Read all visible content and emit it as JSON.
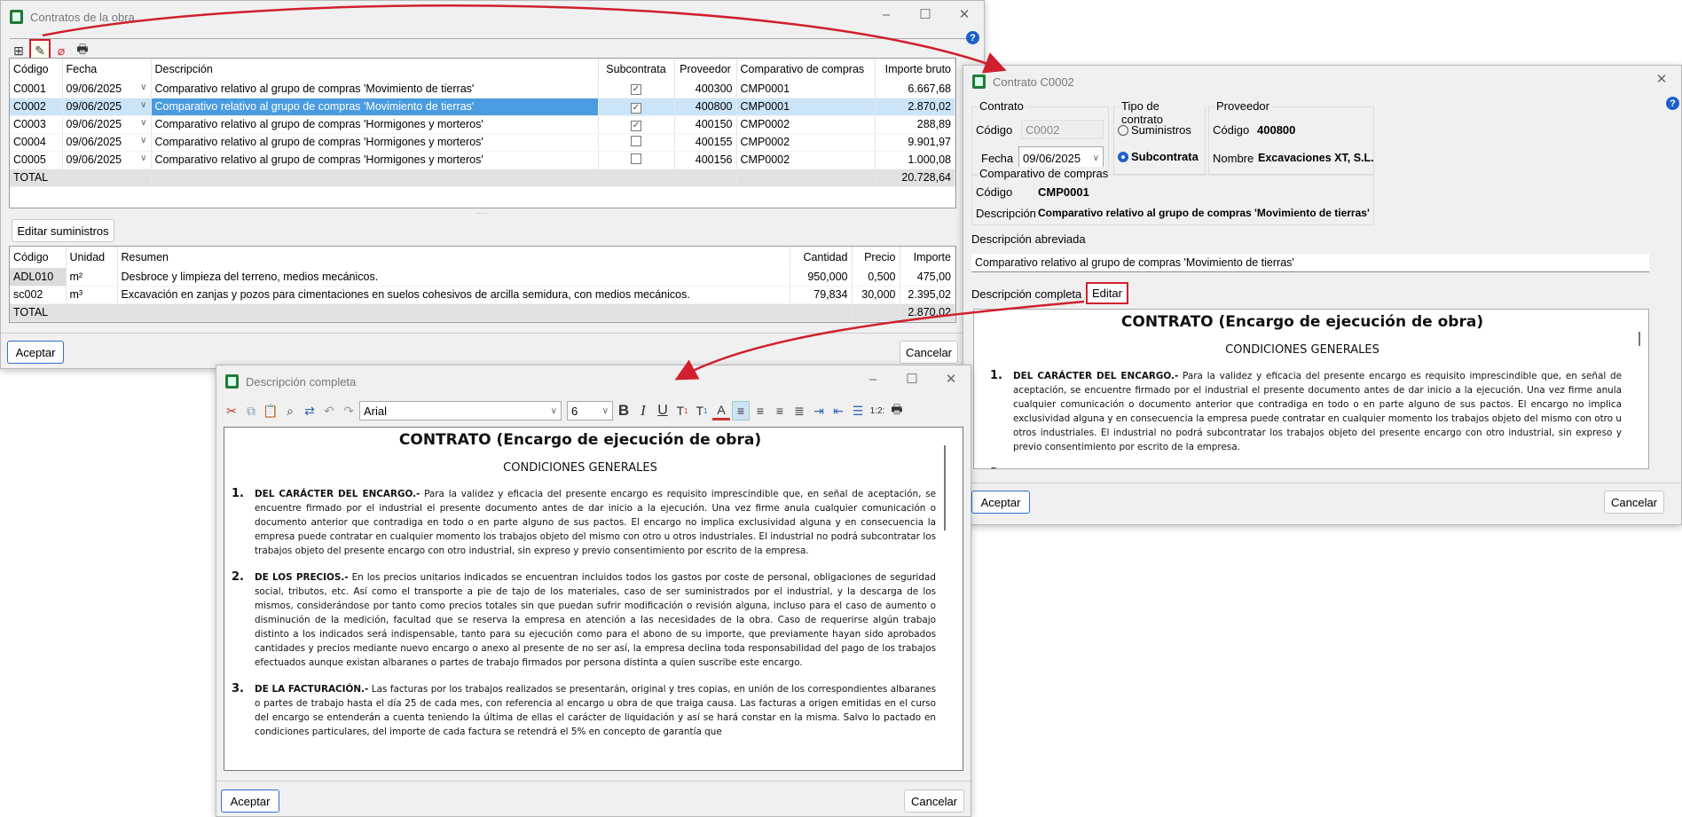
{
  "contracts_window": {
    "title": "Contratos de la obra",
    "toolbar": [
      "new-icon",
      "edit-icon",
      "delete-icon",
      "print-icon"
    ],
    "columns": [
      "Código",
      "Fecha",
      "Descripción",
      "Subcontrata",
      "Proveedor",
      "Comparativo de compras",
      "Importe bruto"
    ],
    "rows": [
      {
        "codigo": "C0001",
        "fecha": "09/06/2025",
        "descripcion": "Comparativo relativo al grupo de compras 'Movimiento de tierras'",
        "subcontrata": true,
        "proveedor": "400300",
        "comparativo": "CMP0001",
        "importe": "6.667,68"
      },
      {
        "codigo": "C0002",
        "fecha": "09/06/2025",
        "descripcion": "Comparativo relativo al grupo de compras 'Movimiento de tierras'",
        "subcontrata": true,
        "proveedor": "400800",
        "comparativo": "CMP0001",
        "importe": "2.870,02"
      },
      {
        "codigo": "C0003",
        "fecha": "09/06/2025",
        "descripcion": "Comparativo relativo al grupo de compras 'Hormigones y morteros'",
        "subcontrata": true,
        "proveedor": "400150",
        "comparativo": "CMP0002",
        "importe": "288,89"
      },
      {
        "codigo": "C0004",
        "fecha": "09/06/2025",
        "descripcion": "Comparativo relativo al grupo de compras 'Hormigones y morteros'",
        "subcontrata": false,
        "proveedor": "400155",
        "comparativo": "CMP0002",
        "importe": "9.901,97"
      },
      {
        "codigo": "C0005",
        "fecha": "09/06/2025",
        "descripcion": "Comparativo relativo al grupo de compras 'Hormigones y morteros'",
        "subcontrata": false,
        "proveedor": "400156",
        "comparativo": "CMP0002",
        "importe": "1.000,08"
      }
    ],
    "total_label": "TOTAL",
    "total": "20.728,64",
    "edit_supplies": "Editar suministros",
    "supplies_columns": [
      "Código",
      "Unidad",
      "Resumen",
      "Cantidad",
      "Precio",
      "Importe"
    ],
    "supplies": [
      {
        "codigo": "ADL010",
        "unidad": "m²",
        "resumen": "Desbroce y limpieza del terreno, medios mecánicos.",
        "cantidad": "950,000",
        "precio": "0,500",
        "importe": "475,00"
      },
      {
        "codigo": "sc002",
        "unidad": "m³",
        "resumen": "Excavación en zanjas y pozos para cimentaciones en suelos cohesivos de arcilla semidura, con medios mecánicos.",
        "cantidad": "79,834",
        "precio": "30,000",
        "importe": "2.395,02"
      }
    ],
    "supplies_total": "2.870,02",
    "accept": "Aceptar",
    "cancel": "Cancelar"
  },
  "contract_window": {
    "title": "Contrato C0002",
    "contrato_group": "Contrato",
    "codigo_label": "Código",
    "codigo": "C0002",
    "fecha_label": "Fecha",
    "fecha": "09/06/2025",
    "tipo_group": "Tipo de contrato",
    "tipo_options": [
      "Suministros",
      "Subcontrata"
    ],
    "tipo_selected": "Subcontrata",
    "proveedor_group": "Proveedor",
    "prov_codigo_label": "Código",
    "prov_codigo": "400800",
    "nombre_label": "Nombre",
    "nombre": "Excavaciones XT, S.L.",
    "comparativo_group": "Comparativo de compras",
    "comp_codigo_label": "Código",
    "comp_codigo": "CMP0001",
    "comp_desc_label": "Descripción",
    "comp_desc": "Comparativo relativo al grupo de compras 'Movimiento de tierras'",
    "desc_abrev_label": "Descripción abreviada",
    "desc_abrev": "Comparativo relativo al grupo de compras 'Movimiento de tierras'",
    "desc_completa_label": "Descripción completa",
    "edit": "Editar",
    "accept": "Aceptar",
    "cancel": "Cancelar"
  },
  "editor_window": {
    "title": "Descripción completa",
    "font": "Arial",
    "size": "6",
    "accept": "Aceptar",
    "cancel": "Cancelar"
  },
  "document": {
    "title": "CONTRATO (Encargo de ejecución de obra)",
    "subtitle": "CONDICIONES GENERALES",
    "clauses": [
      {
        "num": "1.",
        "head": "DEL CARÁCTER DEL ENCARGO.-",
        "text": " Para la validez y eficacia del presente encargo es requisito imprescindible que, en señal de aceptación, se encuentre firmado por el industrial el presente documento antes de dar inicio a la ejecución. Una vez firme anula cualquier comunicación o documento anterior que contradiga en todo o en parte alguno de sus pactos. El encargo no implica exclusividad alguna y en consecuencia la empresa puede contratar en cualquier momento los trabajos objeto del mismo con otro u otros industriales. El industrial no podrá subcontratar los trabajos objeto del presente encargo con otro industrial, sin expreso y previo consentimiento por escrito de la empresa."
      },
      {
        "num": "2.",
        "head": "DE LOS PRECIOS.-",
        "text": "  En los precios unitarios indicados se encuentran incluidos todos los gastos por coste de personal, obligaciones de seguridad social, tributos, etc. Así como el transporte a pie de tajo de los materiales, caso de ser suministrados por el industrial, y la descarga de los mismos, considerándose por tanto como precios totales sin que puedan sufrir modificación o revisión alguna, incluso para el caso de aumento o disminución de la medición, facultad que se reserva la empresa en atención a las necesidades de la obra. Caso de requerirse algún trabajo distinto a los indicados será indispensable, tanto para su ejecución como para el abono de su importe, que previamente hayan sido aprobados cantidades y precios mediante nuevo encargo o anexo al presente de no ser así, la empresa declina toda responsabilidad del pago de los trabajos efectuados aunque existan albaranes o partes de trabajo firmados por persona distinta a quien suscribe este encargo."
      },
      {
        "num": "3.",
        "head": "DE LA FACTURACIÓN.-",
        "text": " Las facturas por los trabajos realizados se presentarán, original y tres copias, en unión de los correspondientes albaranes o partes de trabajo hasta el día 25 de cada mes, con referencia al encargo u obra de que traiga causa. Las facturas a origen emitidas en el curso del encargo se entenderán a cuenta teniendo la última de ellas el carácter de liquidación y así se hará constar en la misma. Salvo lo pactado en condiciones particulares, del importe de cada factura se retendrá el 5% en concepto de garantía que"
      }
    ]
  },
  "colors": {
    "selection": "#4a9be0",
    "selection_light": "#cce4f7",
    "annotation": "#d0202e"
  }
}
